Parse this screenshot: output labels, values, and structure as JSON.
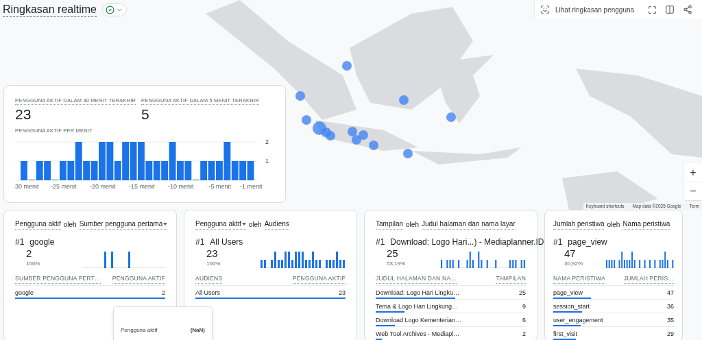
{
  "header": {
    "title": "Ringkasan realtime"
  },
  "toolbar": {
    "user_summary_label": "Lihat ringkasan pengguna"
  },
  "map": {
    "footer": [
      "Keyboard shortcuts",
      "Map data ©2025 Google",
      "Term"
    ],
    "zoom_in": "+",
    "zoom_out": "−"
  },
  "summary": {
    "metrics": [
      {
        "label": "PENGGUNA AKTIF DALAM 30 MENIT TERAKHIR",
        "value": "23"
      },
      {
        "label": "PENGGUNA AKTIF DALAM 5 MENIT TERAKHIR",
        "value": "5"
      }
    ],
    "chart_title": "PENGGUNA AKTIF PER MENIT",
    "chart_data": {
      "type": "bar",
      "x": [
        -30,
        -29,
        -28,
        -27,
        -26,
        -25,
        -24,
        -23,
        -22,
        -21,
        -20,
        -19,
        -18,
        -17,
        -16,
        -15,
        -14,
        -13,
        -12,
        -11,
        -10,
        -9,
        -8,
        -7,
        -6,
        -5,
        -4,
        -3,
        -2,
        -1
      ],
      "series": [
        {
          "color": "#1a73e8",
          "values": [
            1,
            0,
            1,
            1,
            0,
            1,
            1,
            2,
            1,
            1,
            2,
            2,
            1,
            2,
            2,
            2,
            1,
            1,
            1,
            2,
            1,
            1,
            0,
            1,
            1,
            1,
            2,
            1,
            1,
            1
          ]
        }
      ],
      "xticks": [
        {
          "value": -30,
          "label": "30 menit"
        },
        {
          "value": -25,
          "label": "-25 menit"
        },
        {
          "value": -20,
          "label": "-20 menit"
        },
        {
          "value": -15,
          "label": "-15 menit"
        },
        {
          "value": -10,
          "label": "-10 menit"
        },
        {
          "value": -5,
          "label": "-5 menit"
        },
        {
          "value": -1,
          "label": "-1 menit"
        }
      ],
      "yticks": [
        1,
        2
      ],
      "ylim": [
        0,
        2
      ],
      "xlim": [
        -30.5,
        -0.5
      ]
    }
  },
  "cards": [
    {
      "title": {
        "metric": "Pengguna aktif",
        "metric_dropdown": false,
        "joiner": "oleh",
        "dimension": "Sumber pengguna pertama",
        "dimension_dropdown": true
      },
      "top": {
        "rank": "#1",
        "name": "google",
        "value": "2",
        "share": "100%"
      },
      "columns": [
        "SUMBER PENGGUNA PERT…",
        "PENGGUNA AKTIF"
      ],
      "rows": [
        {
          "label": "google",
          "value": "2",
          "level": 1
        }
      ]
    },
    {
      "title": {
        "metric": "Pengguna aktif",
        "metric_dropdown": true,
        "joiner": "oleh",
        "dimension": "Audiens",
        "dimension_dropdown": false
      },
      "top": {
        "rank": "#1",
        "name": "All Users",
        "value": "23",
        "share": "100%"
      },
      "columns": [
        "AUDIENS",
        "PENGGUNA AKTIF"
      ],
      "rows": [
        {
          "label": "All Users",
          "value": "23",
          "level": 1
        }
      ]
    },
    {
      "title": {
        "metric": "Tampilan",
        "metric_dropdown": false,
        "joiner": "oleh",
        "dimension": "Judul halaman dan nama layar",
        "dimension_dropdown": false
      },
      "top": {
        "rank": "#1",
        "name": "Download: Logo Hari...) - Mediaplanner.ID",
        "value": "25",
        "share": "53,19%"
      },
      "columns": [
        "JUDUL HALAMAN DAN NA…",
        "TAMPILAN"
      ],
      "rows": [
        {
          "label": "Download: Logo Hari Lingku…",
          "value": "25",
          "level": 0.53
        },
        {
          "label": "Tema & Logo Hari Lingkung…",
          "value": "9",
          "level": 0.19
        },
        {
          "label": "Download Logo Kementerian…",
          "value": "6",
          "level": 0.13
        },
        {
          "label": "Web Tool Archives - Mediapl…",
          "value": "2",
          "level": 0.04
        }
      ]
    },
    {
      "title": {
        "metric": "Jumlah peristiwa",
        "metric_dropdown": false,
        "joiner": "oleh",
        "dimension": "Nama peristiwa",
        "dimension_dropdown": false
      },
      "top": {
        "rank": "#1",
        "name": "page_view",
        "value": "47",
        "share": "30,92%"
      },
      "columns": [
        "NAMA PERISTIWA",
        "JUMLAH PERIS…"
      ],
      "rows": [
        {
          "label": "page_view",
          "value": "47",
          "level": 0.31
        },
        {
          "label": "session_start",
          "value": "36",
          "level": 0.24
        },
        {
          "label": "user_engagement",
          "value": "35",
          "level": 0.23
        },
        {
          "label": "first_visit",
          "value": "29",
          "level": 0.19
        }
      ]
    }
  ],
  "tooltip": {
    "label": "Pengguna aktif",
    "value": "(NaN)"
  }
}
